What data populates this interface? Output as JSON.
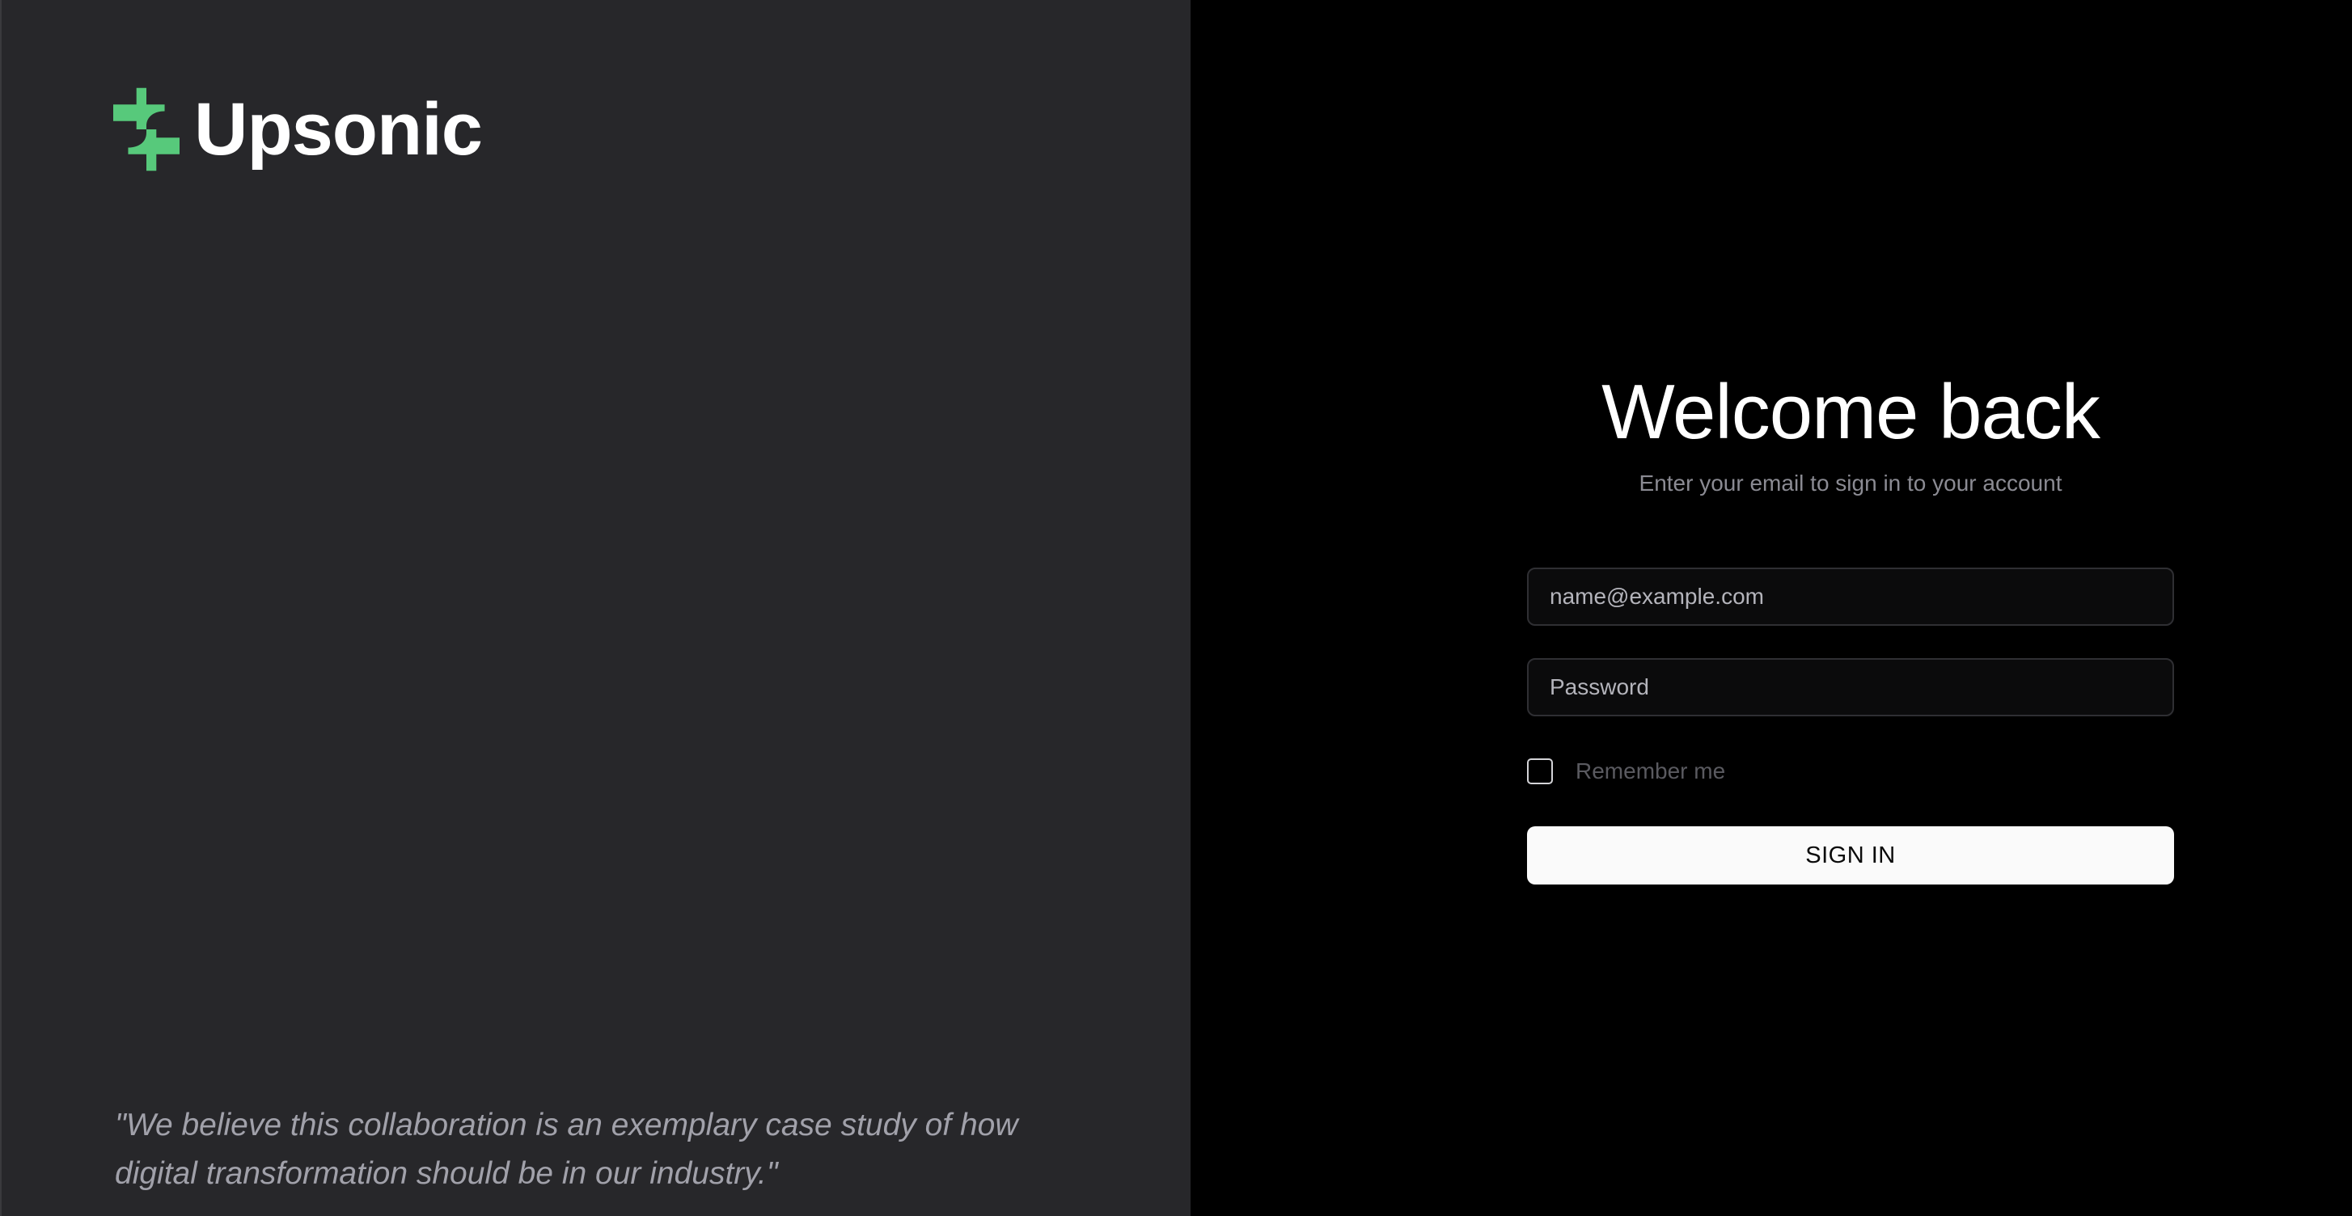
{
  "brand": {
    "name": "Upsonic",
    "logo_icon": "upsonic-logo-icon",
    "accent_color": "#57c97b"
  },
  "quote": {
    "text": "\"We believe this collaboration is an exemplary case study of how digital transformation should be in our industry.\""
  },
  "login": {
    "title": "Welcome back",
    "subtitle": "Enter your email to sign in to your account",
    "email_placeholder": "name@example.com",
    "password_placeholder": "Password",
    "remember_label": "Remember me",
    "remember_checked": false,
    "submit_label": "SIGN IN"
  },
  "colors": {
    "left_background": "#27272a",
    "right_background": "#000000",
    "button_background": "#fafafa"
  }
}
